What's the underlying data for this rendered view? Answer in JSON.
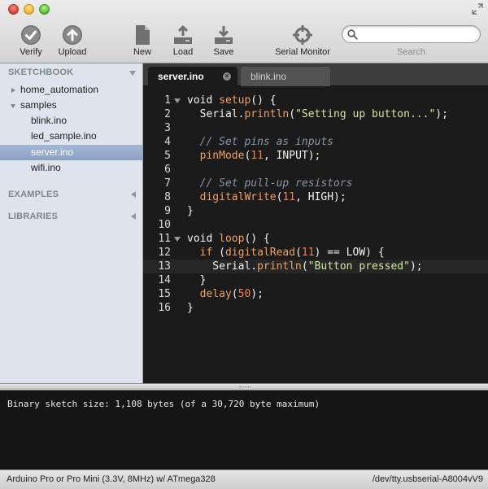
{
  "toolbar": {
    "verify_label": "Verify",
    "upload_label": "Upload",
    "new_label": "New",
    "load_label": "Load",
    "save_label": "Save",
    "serial_monitor_label": "Serial Monitor",
    "search_label": "Search",
    "search_value": ""
  },
  "sidebar": {
    "sketchbook_title": "SKETCHBOOK",
    "items": [
      {
        "label": "home_automation"
      },
      {
        "label": "samples"
      },
      {
        "label": "blink.ino"
      },
      {
        "label": "led_sample.ino"
      },
      {
        "label": "server.ino"
      },
      {
        "label": "wifi.ino"
      }
    ],
    "examples_title": "EXAMPLES",
    "libraries_title": "LIBRARIES"
  },
  "tabs": [
    {
      "label": "server.ino",
      "active": true
    },
    {
      "label": "blink.ino",
      "active": false
    }
  ],
  "editor": {
    "current_line": 13,
    "lines": [
      {
        "n": "1",
        "tokens": [
          [
            "kw",
            "void "
          ],
          [
            "fn",
            "setup"
          ],
          [
            "kw",
            "() {"
          ]
        ]
      },
      {
        "n": "2",
        "tokens": [
          [
            "kw",
            "  Serial."
          ],
          [
            "fn",
            "println"
          ],
          [
            "kw",
            "("
          ],
          [
            "str",
            "\"Setting up button...\""
          ],
          [
            "kw",
            ");"
          ]
        ]
      },
      {
        "n": "3",
        "tokens": []
      },
      {
        "n": "4",
        "tokens": [
          [
            "cm",
            "  // Set pins as inputs"
          ]
        ]
      },
      {
        "n": "5",
        "tokens": [
          [
            "fn",
            "  pinMode"
          ],
          [
            "kw",
            "("
          ],
          [
            "num",
            "11"
          ],
          [
            "kw",
            ", INPUT);"
          ]
        ]
      },
      {
        "n": "6",
        "tokens": []
      },
      {
        "n": "7",
        "tokens": [
          [
            "cm",
            "  // Set pull-up resistors"
          ]
        ]
      },
      {
        "n": "8",
        "tokens": [
          [
            "fn",
            "  digitalWrite"
          ],
          [
            "kw",
            "("
          ],
          [
            "num",
            "11"
          ],
          [
            "kw",
            ", HIGH);"
          ]
        ]
      },
      {
        "n": "9",
        "tokens": [
          [
            "kw",
            "}"
          ]
        ]
      },
      {
        "n": "10",
        "tokens": []
      },
      {
        "n": "11",
        "tokens": [
          [
            "kw",
            "void "
          ],
          [
            "fn",
            "loop"
          ],
          [
            "kw",
            "() {"
          ]
        ]
      },
      {
        "n": "12",
        "tokens": [
          [
            "fn",
            "  if"
          ],
          [
            "kw",
            " ("
          ],
          [
            "fn",
            "digitalRead"
          ],
          [
            "kw",
            "("
          ],
          [
            "num",
            "11"
          ],
          [
            "kw",
            ") == LOW) {"
          ]
        ]
      },
      {
        "n": "13",
        "tokens": [
          [
            "kw",
            "    Serial."
          ],
          [
            "fn",
            "println"
          ],
          [
            "kw",
            "("
          ],
          [
            "str",
            "\"Button pressed\""
          ],
          [
            "kw",
            ");"
          ]
        ]
      },
      {
        "n": "14",
        "tokens": [
          [
            "kw",
            "  }"
          ]
        ]
      },
      {
        "n": "15",
        "tokens": [
          [
            "fn",
            "  delay"
          ],
          [
            "kw",
            "("
          ],
          [
            "num",
            "50"
          ],
          [
            "kw",
            ");"
          ]
        ]
      },
      {
        "n": "16",
        "tokens": [
          [
            "kw",
            "}"
          ]
        ]
      }
    ]
  },
  "console": {
    "message": "Binary sketch size: 1,108 bytes (of a 30,720 byte maximum)"
  },
  "status": {
    "board": "Arduino Pro or Pro Mini (3.3V, 8MHz) w/ ATmega328",
    "port": "/dev/tty.usbserial-A8004vV9"
  }
}
